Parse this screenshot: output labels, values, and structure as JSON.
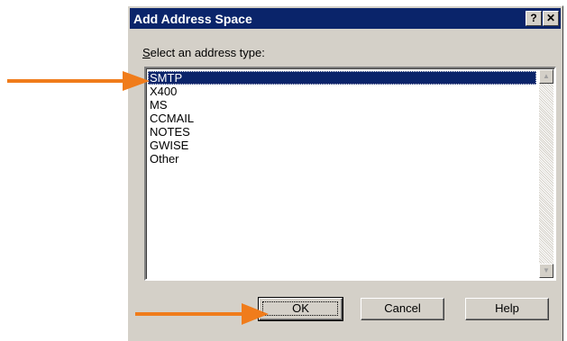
{
  "dialog": {
    "title": "Add Address Space",
    "title_buttons": {
      "help": "?",
      "close": "✕"
    },
    "prompt_accel": "S",
    "prompt_rest": "elect an address type:"
  },
  "list": {
    "items": [
      "SMTP",
      "X400",
      "MS",
      "CCMAIL",
      "NOTES",
      "GWISE",
      "Other"
    ],
    "selected": "SMTP"
  },
  "buttons": {
    "ok": "OK",
    "cancel": "Cancel",
    "help": "Help"
  },
  "icons": {
    "scroll_up": "▲",
    "scroll_down": "▼"
  },
  "colors": {
    "annotation_arrow": "#f07c1b",
    "title_bar": "#0a246a",
    "dialog_face": "#d4d0c8",
    "selection": "#0a246a"
  }
}
